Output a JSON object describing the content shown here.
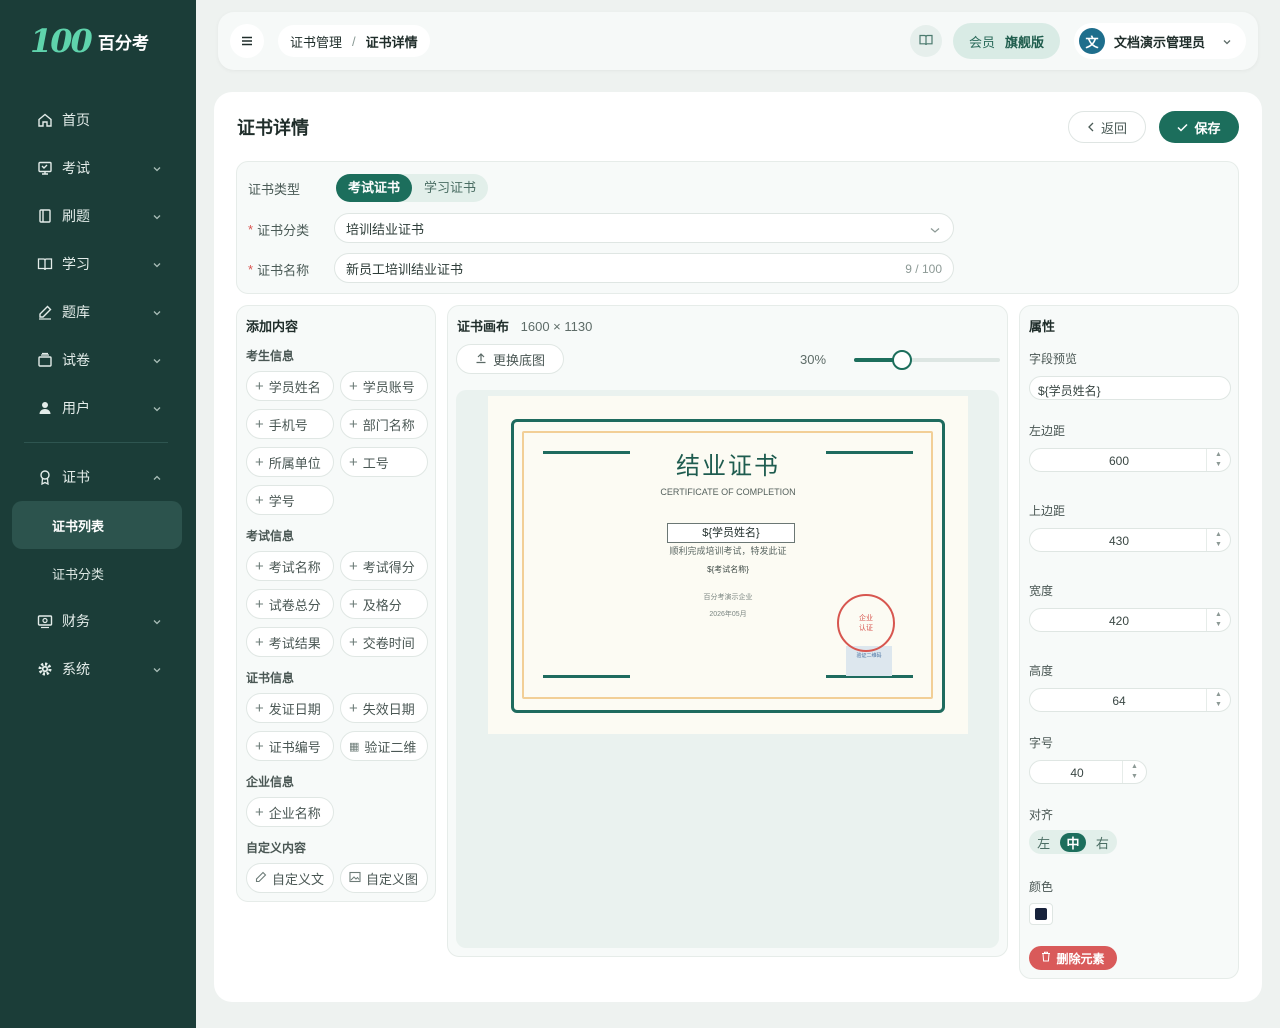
{
  "brand": {
    "logo": "100",
    "name": "百分考"
  },
  "nav": {
    "items": [
      {
        "label": "首页",
        "icon": "home-icon"
      },
      {
        "label": "考试",
        "icon": "exam-icon"
      },
      {
        "label": "刷题",
        "icon": "practice-icon"
      },
      {
        "label": "学习",
        "icon": "book-icon"
      },
      {
        "label": "题库",
        "icon": "pen-icon"
      },
      {
        "label": "试卷",
        "icon": "paper-icon"
      },
      {
        "label": "用户",
        "icon": "user-icon"
      }
    ],
    "cert": {
      "label": "证书",
      "icon": "cert-icon"
    },
    "sub": [
      "证书列表",
      "证书分类"
    ],
    "bottom": [
      {
        "label": "财务",
        "icon": "finance-icon"
      },
      {
        "label": "系统",
        "icon": "gear-icon"
      }
    ]
  },
  "topbar": {
    "crumbs": [
      "证书管理",
      "证书详情"
    ],
    "vip_label": "会员",
    "vip_plan": "旗舰版",
    "avatar": "文",
    "user": "文档演示管理员"
  },
  "page": {
    "title": "证书详情",
    "back": "返回",
    "save": "保存"
  },
  "form": {
    "type_label": "证书类型",
    "types": [
      "考试证书",
      "学习证书"
    ],
    "category_label": "证书分类",
    "category_value": "培训结业证书",
    "name_label": "证书名称",
    "name_value": "新员工培训结业证书",
    "name_count": "9 / 100"
  },
  "content": {
    "title": "添加内容",
    "groups": [
      {
        "title": "考生信息",
        "items": [
          "学员姓名",
          "学员账号",
          "手机号",
          "部门名称",
          "所属单位",
          "工号",
          "学号"
        ]
      },
      {
        "title": "考试信息",
        "items": [
          "考试名称",
          "考试得分",
          "试卷总分",
          "及格分",
          "考试结果",
          "交卷时间"
        ]
      },
      {
        "title": "证书信息",
        "items": [
          "发证日期",
          "失效日期",
          "证书编号",
          "验证二维"
        ]
      },
      {
        "title": "企业信息",
        "items": [
          "企业名称"
        ]
      },
      {
        "title": "自定义内容",
        "items": [
          "自定义文",
          "自定义图"
        ]
      }
    ]
  },
  "canvas": {
    "title": "证书画布",
    "size": "1600 × 1130",
    "upload": "更换底图",
    "zoom": "30%",
    "zoom_value": 0.3
  },
  "cert": {
    "title": "结业证书",
    "subtitle": "CERTIFICATE OF COMPLETION",
    "name": "${学员姓名}",
    "desc": "顺利完成培训考试，特发此证",
    "exam": "${考试名称}",
    "company": "百分考演示企业",
    "date": "2026年05月",
    "seal_line1": "企业",
    "seal_line2": "认证",
    "qr": "验证二维码"
  },
  "props": {
    "title": "属性",
    "field_label": "字段预览",
    "field_value": "${学员姓名}",
    "left_label": "左边距",
    "left": "600",
    "top_label": "上边距",
    "top": "430",
    "width_label": "宽度",
    "width": "420",
    "height_label": "高度",
    "height": "64",
    "font_label": "字号",
    "font": "40",
    "align_label": "对齐",
    "align": [
      "左",
      "中",
      "右"
    ],
    "color_label": "颜色",
    "color": "#17223b",
    "delete": "删除元素"
  },
  "colors": {
    "sidebar": "#1b3d38",
    "accent": "#1c6e5c",
    "danger": "#d95a5a"
  }
}
